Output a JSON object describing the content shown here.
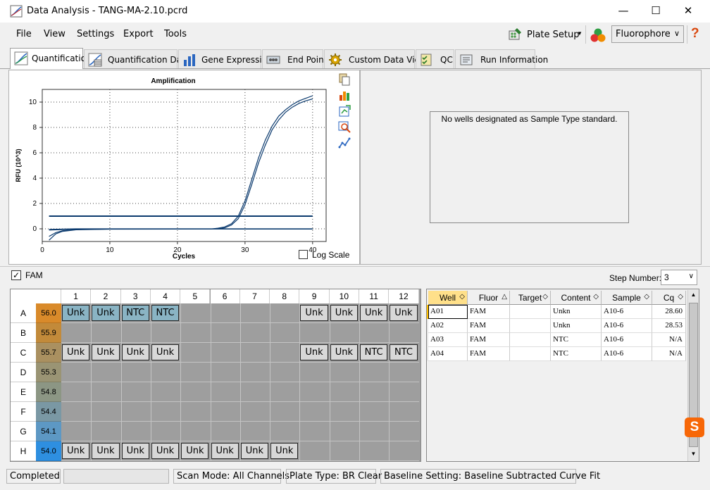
{
  "window": {
    "title": "Data Analysis - TANG-MA-2.10.pcrd",
    "minimize": "—",
    "maximize": "☐",
    "close": "✕"
  },
  "menu": [
    "File",
    "View",
    "Settings",
    "Export",
    "Tools"
  ],
  "toolbar": {
    "plate_setup": "Plate Setup",
    "fluorophore": "Fluorophore",
    "help": "?"
  },
  "tabs": [
    {
      "label": "Quantification",
      "active": true
    },
    {
      "label": "Quantification Data"
    },
    {
      "label": "Gene Expression"
    },
    {
      "label": "End Point"
    },
    {
      "label": "Custom Data View"
    },
    {
      "label": "QC"
    },
    {
      "label": "Run Information"
    }
  ],
  "chart_data": {
    "type": "line",
    "title": "Amplification",
    "xlabel": "Cycles",
    "ylabel": "RFU (10^3)",
    "xlim": [
      0,
      42
    ],
    "ylim": [
      -1,
      11
    ],
    "xticks": [
      0,
      10,
      20,
      30,
      40
    ],
    "yticks": [
      0,
      2,
      4,
      6,
      8,
      10
    ],
    "grid": true,
    "threshold": 1.0,
    "series": [
      {
        "values": [
          [
            1,
            -0.9
          ],
          [
            2,
            -0.4
          ],
          [
            3,
            -0.2
          ],
          [
            5,
            -0.08
          ],
          [
            10,
            -0.03
          ],
          [
            20,
            -0.02
          ],
          [
            25,
            -0.01
          ],
          [
            26,
            0.05
          ],
          [
            27,
            0.15
          ],
          [
            28,
            0.4
          ],
          [
            29,
            1.0
          ],
          [
            30,
            2.2
          ],
          [
            31,
            3.9
          ],
          [
            32,
            5.6
          ],
          [
            33,
            7.0
          ],
          [
            34,
            8.1
          ],
          [
            35,
            8.9
          ],
          [
            36,
            9.4
          ],
          [
            37,
            9.8
          ],
          [
            38,
            10.1
          ],
          [
            39,
            10.3
          ],
          [
            40,
            10.5
          ]
        ]
      },
      {
        "values": [
          [
            1,
            -0.6
          ],
          [
            2,
            -0.3
          ],
          [
            3,
            -0.15
          ],
          [
            5,
            -0.06
          ],
          [
            10,
            -0.02
          ],
          [
            20,
            -0.01
          ],
          [
            26,
            0.0
          ],
          [
            27,
            0.08
          ],
          [
            28,
            0.3
          ],
          [
            29,
            0.8
          ],
          [
            30,
            1.9
          ],
          [
            31,
            3.5
          ],
          [
            32,
            5.2
          ],
          [
            33,
            6.6
          ],
          [
            34,
            7.8
          ],
          [
            35,
            8.6
          ],
          [
            36,
            9.2
          ],
          [
            37,
            9.6
          ],
          [
            38,
            9.9
          ],
          [
            39,
            10.1
          ],
          [
            40,
            10.25
          ]
        ]
      },
      {
        "values": [
          [
            1,
            -0.1
          ],
          [
            5,
            -0.02
          ],
          [
            10,
            -0.01
          ],
          [
            20,
            -0.01
          ],
          [
            30,
            -0.02
          ],
          [
            40,
            -0.02
          ]
        ]
      },
      {
        "values": [
          [
            1,
            -0.05
          ],
          [
            5,
            0.0
          ],
          [
            10,
            0.0
          ],
          [
            20,
            0.0
          ],
          [
            30,
            0.0
          ],
          [
            40,
            0.0
          ]
        ]
      }
    ],
    "log_scale_label": "Log Scale",
    "log_scale_checked": false
  },
  "standard_panel": {
    "message": "No wells designated as Sample Type standard."
  },
  "fam": {
    "label": "FAM",
    "checked": true,
    "check_glyph": "✓"
  },
  "step": {
    "label": "Step Number:",
    "value": "3"
  },
  "plate": {
    "columns": [
      "1",
      "2",
      "3",
      "4",
      "5",
      "6",
      "7",
      "8",
      "9",
      "10",
      "11",
      "12"
    ],
    "rows": [
      {
        "label": "A",
        "temp": "56.0",
        "color": "#d98a2a",
        "wells": [
          "Unk",
          "Unk",
          "NTC",
          "NTC",
          "",
          "",
          "",
          "",
          "Unk",
          "Unk",
          "Unk",
          "Unk"
        ],
        "selected": [
          true,
          true,
          true,
          true,
          false,
          false,
          false,
          false,
          false,
          false,
          false,
          false
        ]
      },
      {
        "label": "B",
        "temp": "55.9",
        "color": "#c28a3a",
        "wells": [
          "",
          "",
          "",
          "",
          "",
          "",
          "",
          "",
          "",
          "",
          "",
          ""
        ]
      },
      {
        "label": "C",
        "temp": "55.7",
        "color": "#aa9060",
        "wells": [
          "Unk",
          "Unk",
          "Unk",
          "Unk",
          "",
          "",
          "",
          "",
          "Unk",
          "Unk",
          "NTC",
          "NTC"
        ]
      },
      {
        "label": "D",
        "temp": "55.3",
        "color": "#9a9474",
        "wells": [
          "",
          "",
          "",
          "",
          "",
          "",
          "",
          "",
          "",
          "",
          "",
          ""
        ]
      },
      {
        "label": "E",
        "temp": "54.8",
        "color": "#8c9684",
        "wells": [
          "",
          "",
          "",
          "",
          "",
          "",
          "",
          "",
          "",
          "",
          "",
          ""
        ]
      },
      {
        "label": "F",
        "temp": "54.4",
        "color": "#7a98a4",
        "wells": [
          "",
          "",
          "",
          "",
          "",
          "",
          "",
          "",
          "",
          "",
          "",
          ""
        ]
      },
      {
        "label": "G",
        "temp": "54.1",
        "color": "#5d98c4",
        "wells": [
          "",
          "",
          "",
          "",
          "",
          "",
          "",
          "",
          "",
          "",
          "",
          ""
        ]
      },
      {
        "label": "H",
        "temp": "54.0",
        "color": "#2e8fe0",
        "wells": [
          "Unk",
          "Unk",
          "Unk",
          "Unk",
          "Unk",
          "Unk",
          "Unk",
          "Unk",
          "",
          "",
          "",
          ""
        ]
      }
    ]
  },
  "table": {
    "headers": [
      "Well",
      "Fluor",
      "Target",
      "Content",
      "Sample",
      "Cq"
    ],
    "sort_glyphs": [
      "◇",
      "△",
      "◇",
      "◇",
      "◇",
      "◇"
    ],
    "rows": [
      [
        "A01",
        "FAM",
        "",
        "Unkn",
        "A10-6",
        "28.60"
      ],
      [
        "A02",
        "FAM",
        "",
        "Unkn",
        "A10-6",
        "28.53"
      ],
      [
        "A03",
        "FAM",
        "",
        "NTC",
        "A10-6",
        "N/A"
      ],
      [
        "A04",
        "FAM",
        "",
        "NTC",
        "A10-6",
        "N/A"
      ]
    ]
  },
  "status": {
    "state": "Completed",
    "scan_mode": "Scan Mode: All Channels",
    "plate_type": "Plate Type: BR Clear",
    "baseline": "Baseline Setting: Baseline Subtracted Curve Fit"
  },
  "colors": {
    "curve": "#0b3a6e",
    "accent": "#ffc000",
    "selected_well": "#8ab4c4"
  }
}
